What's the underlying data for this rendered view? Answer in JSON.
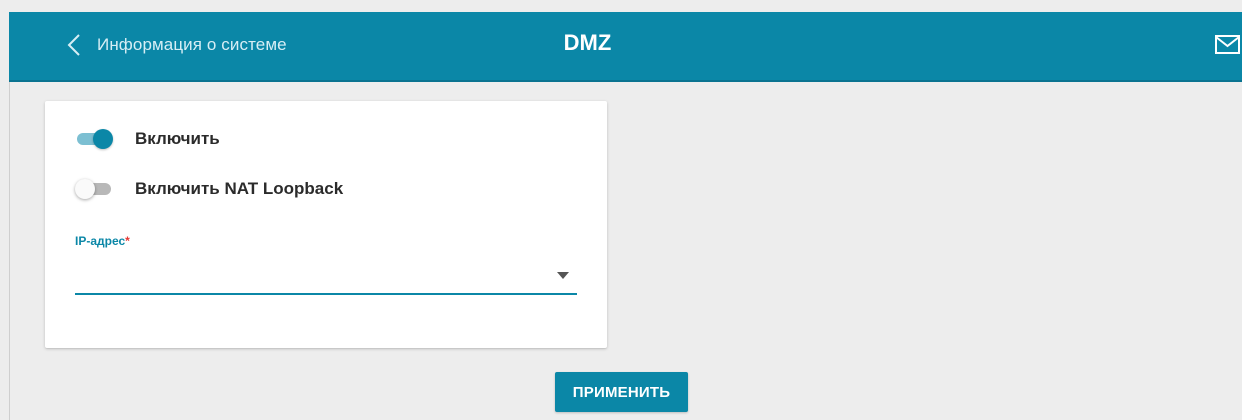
{
  "header": {
    "back_label": "Информация о системе",
    "title": "DMZ",
    "back_icon": "chevron-left-icon",
    "mail_icon": "envelope-icon"
  },
  "form": {
    "enable_toggle": {
      "label": "Включить",
      "checked": true
    },
    "nat_loopback_toggle": {
      "label": "Включить NAT Loopback",
      "checked": false
    },
    "ip_field": {
      "label": "IP-адрес",
      "required_mark": "*",
      "value": "",
      "dropdown_icon": "caret-down-icon"
    }
  },
  "actions": {
    "apply_label": "ПРИМЕНИТЬ"
  },
  "colors": {
    "accent": "#0b87a7",
    "background": "#ededed",
    "card": "#ffffff",
    "required": "#e53935"
  }
}
